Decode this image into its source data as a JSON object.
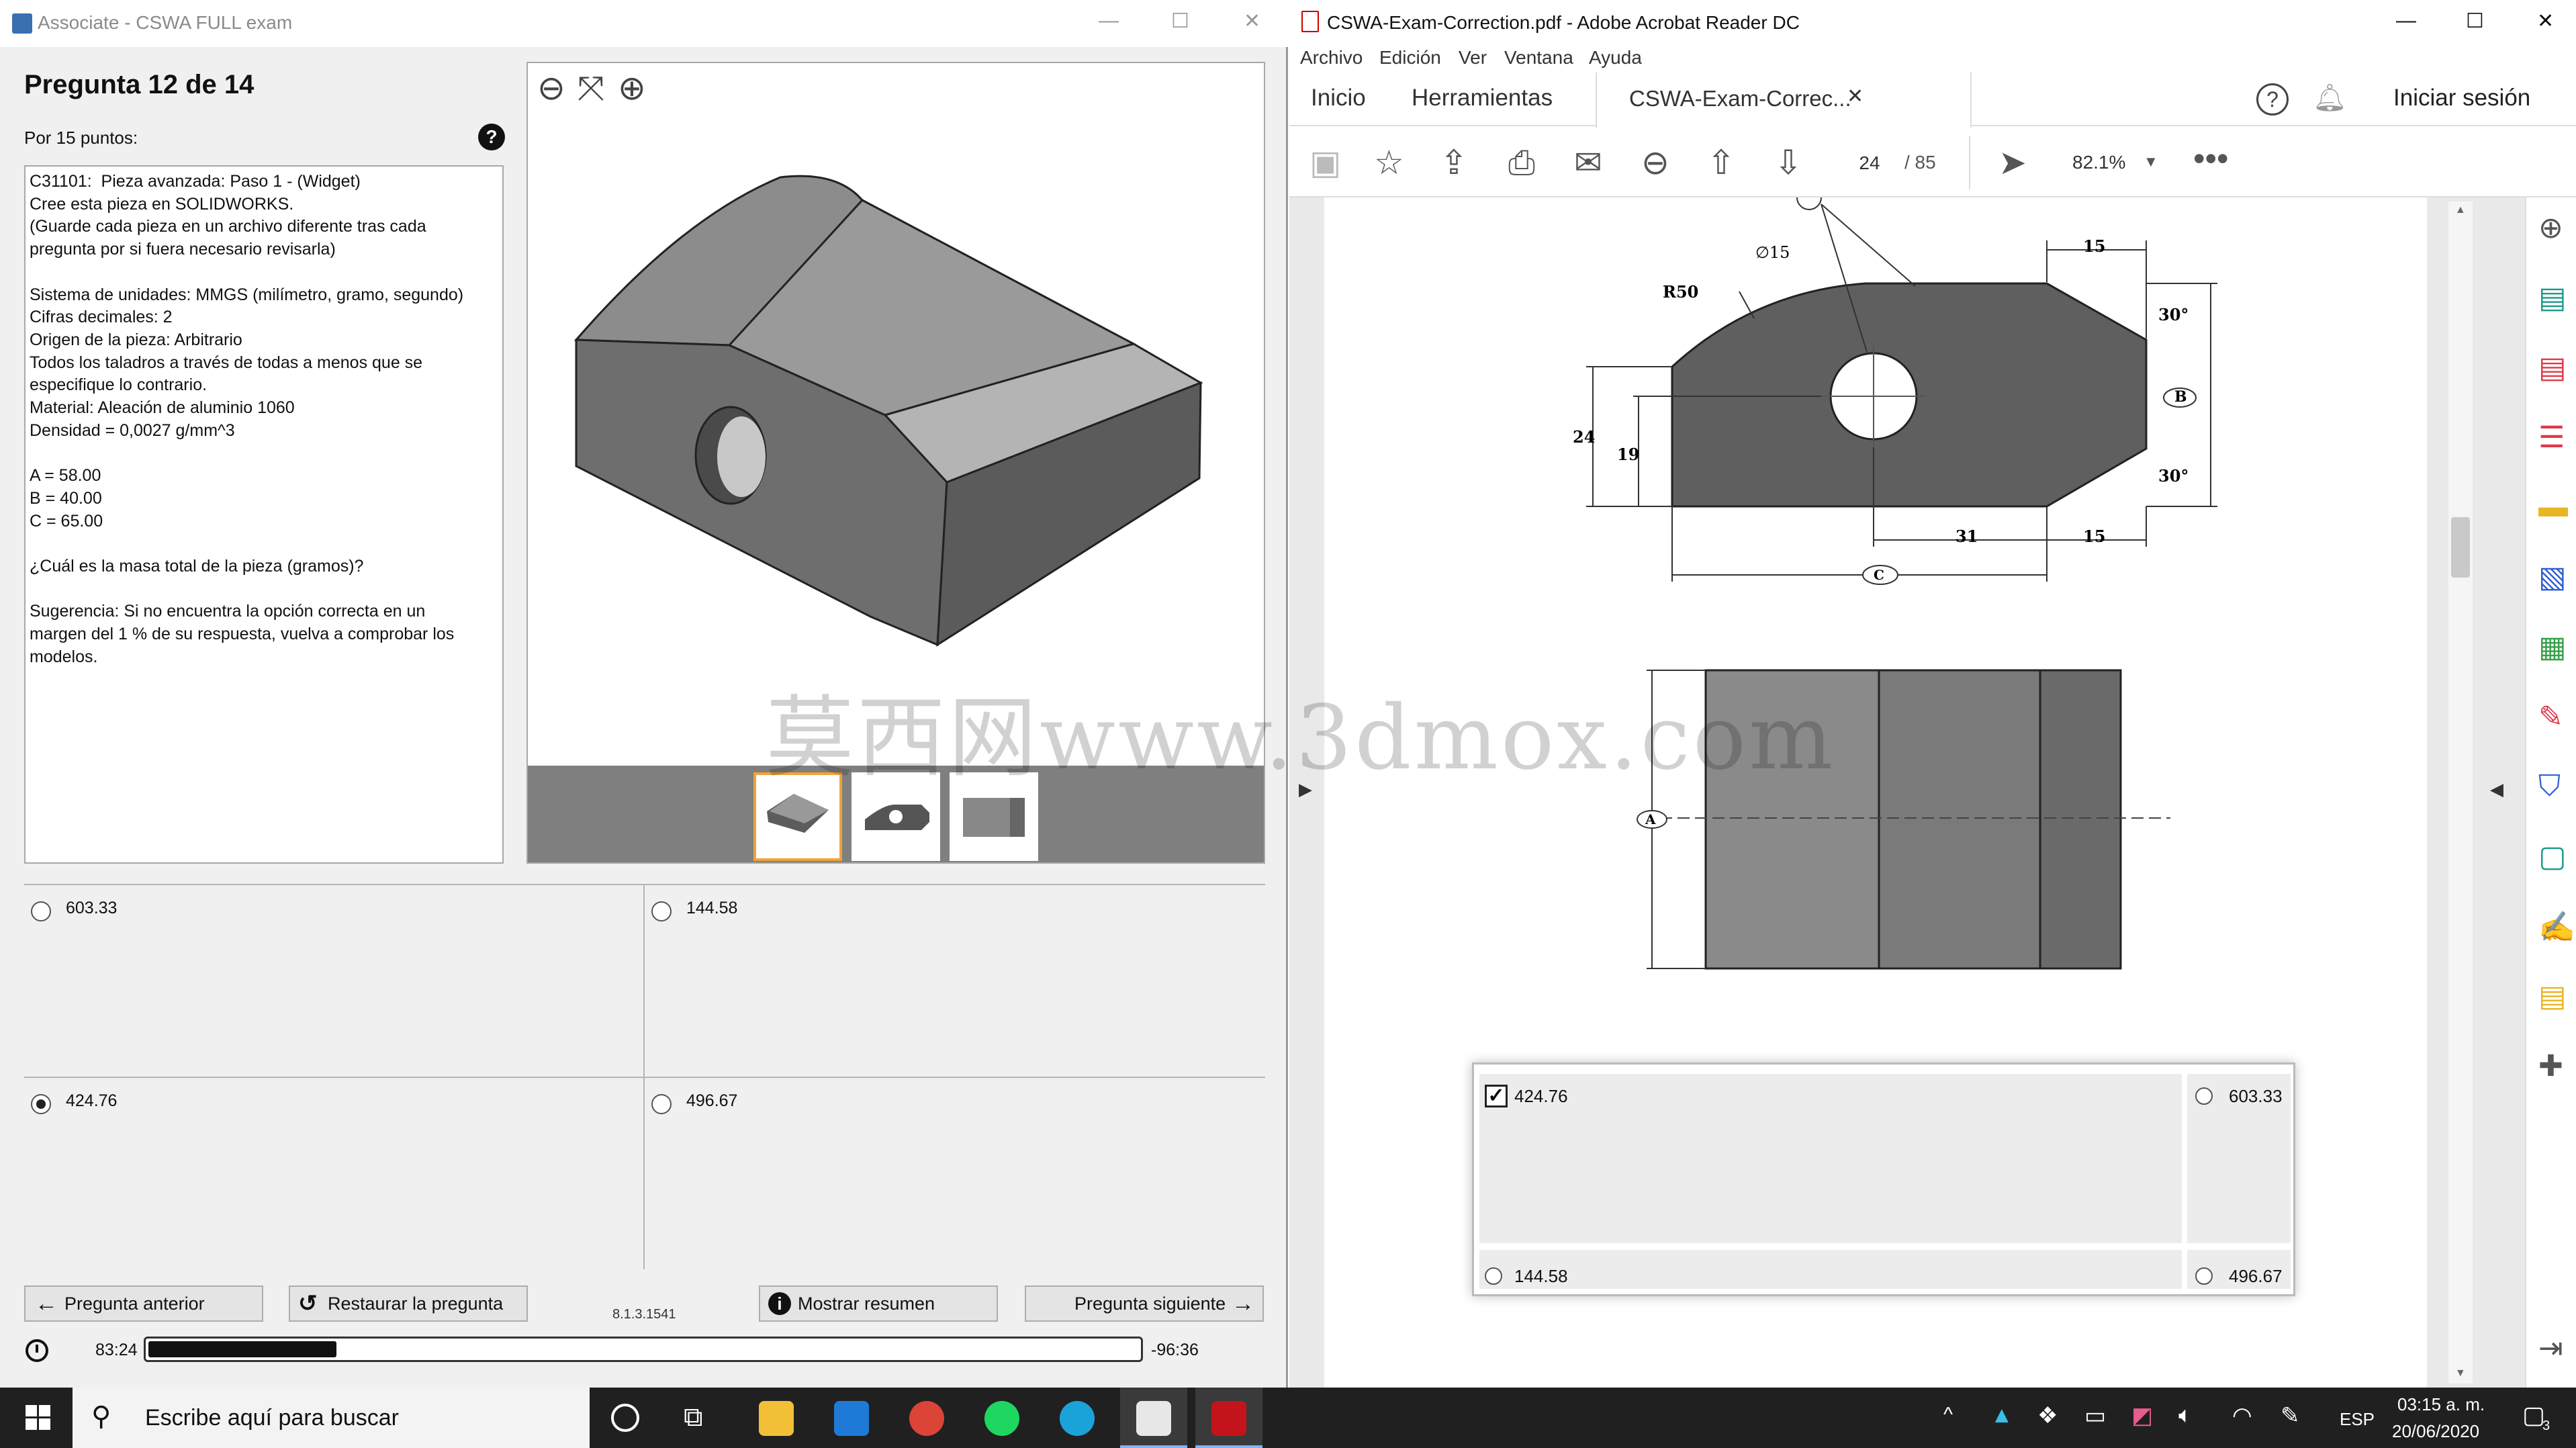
{
  "exam_window": {
    "title": "Associate - CSWA FULL exam",
    "question_heading": "Pregunta 12 de 14",
    "points": "Por 15 puntos:",
    "question_lines": [
      "C31101:  Pieza avanzada: Paso 1 - (Widget)",
      "Cree esta pieza en SOLIDWORKS.",
      "(Guarde cada pieza en un archivo diferente tras cada",
      "pregunta por si fuera necesario revisarla)",
      "",
      "Sistema de unidades: MMGS (milímetro, gramo, segundo)",
      "Cifras decimales: 2",
      "Origen de la pieza: Arbitrario",
      "Todos los taladros a través de todas a menos que se",
      "especifique lo contrario.",
      "Material: Aleación de aluminio 1060",
      "Densidad = 0,0027 g/mm^3",
      "",
      "A = 58.00",
      "B = 40.00",
      "C = 65.00",
      "",
      "¿Cuál es la masa total de la pieza (gramos)?",
      "",
      "Sugerencia: Si no encuentra la opción correcta en un",
      "margen del 1 % de su respuesta, vuelva a comprobar los",
      "modelos."
    ],
    "answers": [
      {
        "value": "603.33",
        "selected": false
      },
      {
        "value": "144.58",
        "selected": false
      },
      {
        "value": "424.76",
        "selected": true
      },
      {
        "value": "496.67",
        "selected": false
      }
    ],
    "buttons": {
      "prev": "Pregunta anterior",
      "reset": "Restaurar la pregunta",
      "summary": "Mostrar resumen",
      "next": "Pregunta siguiente"
    },
    "version": "8.1.3.1541",
    "elapsed": "83:24",
    "remaining": "-96:36",
    "progress_fraction": 0.19
  },
  "acrobat": {
    "title": "CSWA-Exam-Correction.pdf - Adobe Acrobat Reader DC",
    "menu": [
      "Archivo",
      "Edición",
      "Ver",
      "Ventana",
      "Ayuda"
    ],
    "tabs": {
      "home": "Inicio",
      "tools": "Herramientas",
      "doc": "CSWA-Exam-Correc..."
    },
    "sign_in": "Iniciar sesión",
    "page_current": "24",
    "page_total": "/  85",
    "zoom": "82.1%",
    "share": "Compartir",
    "drawing": {
      "r50": "R50",
      "hole": "∅15",
      "dim_15_top": "15",
      "dim_30_top": "30°",
      "dim_b": "B",
      "dim_30_bot": "30°",
      "dim_24": "24",
      "dim_19": "19",
      "dim_31": "31",
      "dim_15_bot": "15",
      "dim_c": "C",
      "dim_a": "A"
    },
    "answer_sheet": [
      {
        "value": "424.76",
        "kind": "checked"
      },
      {
        "value": "603.33",
        "kind": "radio"
      },
      {
        "value": "144.58",
        "kind": "radio"
      },
      {
        "value": "496.67",
        "kind": "radio"
      }
    ]
  },
  "watermark": "莫西网www.3dmox.com",
  "taskbar": {
    "search_placeholder": "Escribe aquí para buscar",
    "lang": "ESP",
    "time": "03:15 a. m.",
    "date": "20/06/2020",
    "notif_count": "3"
  }
}
